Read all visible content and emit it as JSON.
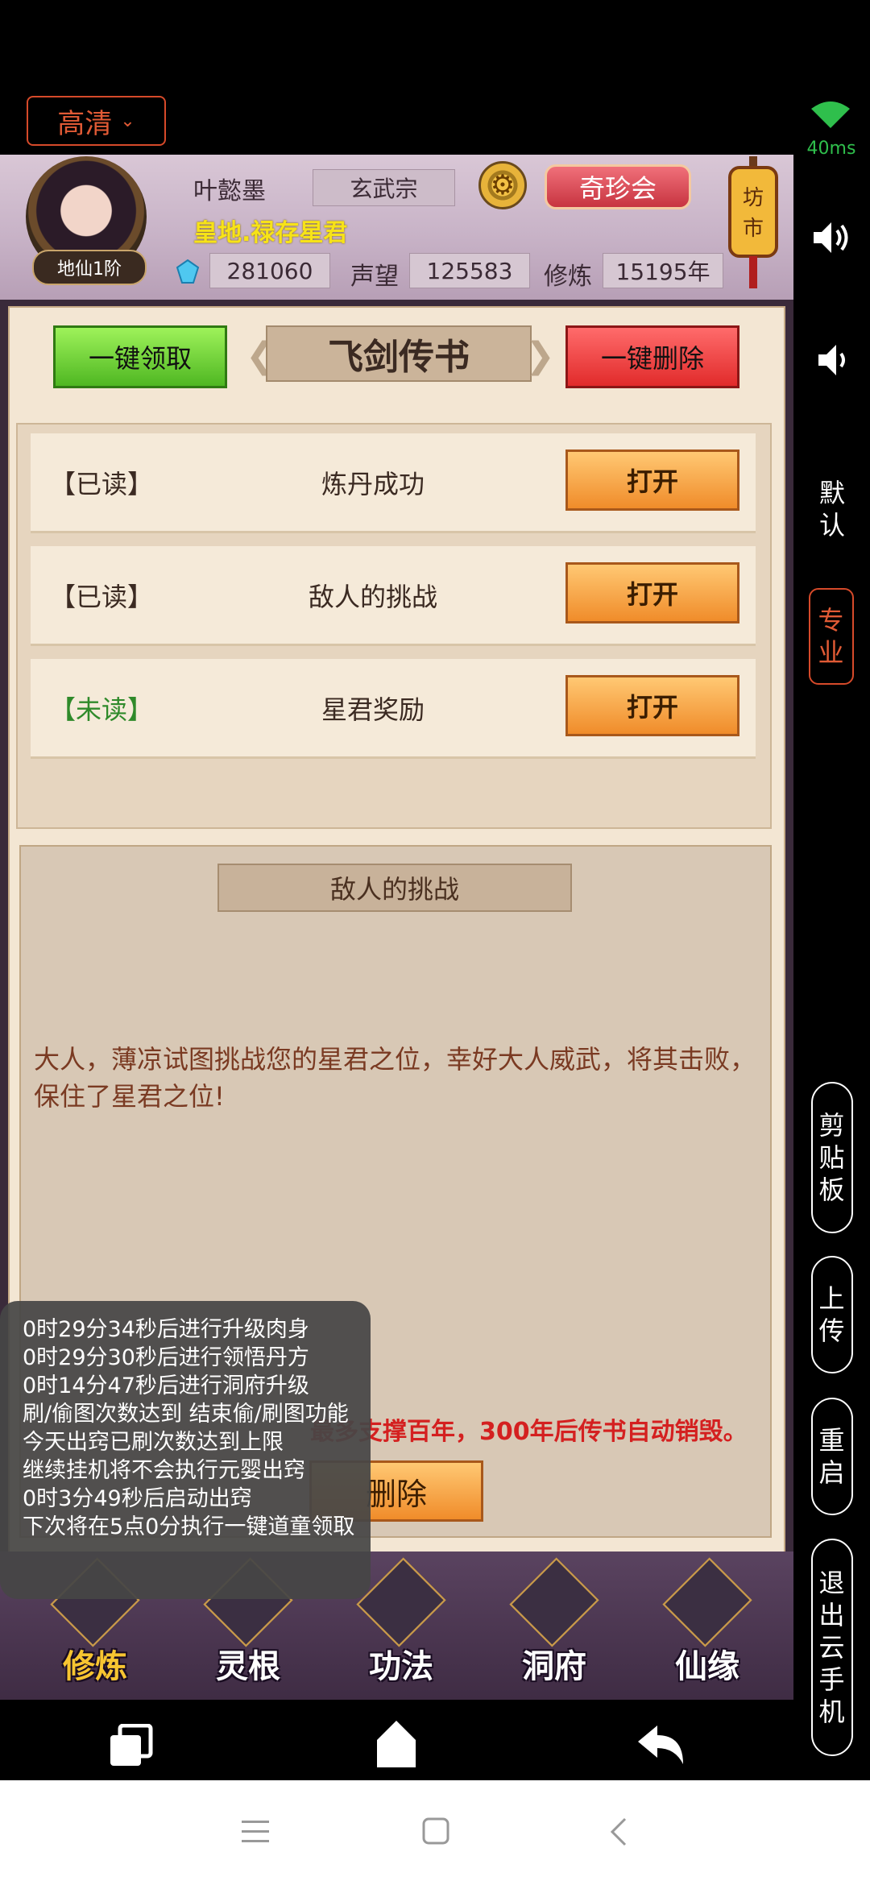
{
  "top_bar": {
    "quality_label": "高清",
    "ping": "40ms"
  },
  "header": {
    "player_name": "叶懿墨",
    "sect": "玄武宗",
    "treasure_button": "奇珍会",
    "market_label": "坊市",
    "title": "皇地.禄存星君",
    "rank": "地仙1阶",
    "spirit_stones": "281060",
    "reputation_label": "声望",
    "reputation": "125583",
    "cultivation_label": "修炼",
    "cultivation": "15195年"
  },
  "panel": {
    "claim_all": "一键领取",
    "title": "飞剑传书",
    "delete_all": "一键删除",
    "messages": [
      {
        "status": "【已读】",
        "title": "炼丹成功",
        "open": "打开"
      },
      {
        "status": "【已读】",
        "title": "敌人的挑战",
        "open": "打开"
      },
      {
        "status": "【未读】",
        "title": "星君奖励",
        "open": "打开"
      }
    ],
    "detail_title": "敌人的挑战",
    "detail_body": "大人，薄凉试图挑战您的星君之位，幸好大人威武，将其击败，保住了星君之位!",
    "notice": "最多支撑百年，300年后传书自动销毁。",
    "delete": "删除"
  },
  "bottom_nav": [
    "修炼",
    "灵根",
    "功法",
    "洞府",
    "仙缘"
  ],
  "log": [
    "0时29分34秒后进行升级肉身",
    "0时29分30秒后进行领悟丹方",
    "0时14分47秒后进行洞府升级",
    "刷/偷图次数达到 结束偷/刷图功能",
    "今天出窍已刷次数达到上限",
    "继续挂机将不会执行元婴出窍",
    "0时3分49秒后启动出窍",
    "下次将在5点0分执行一键道童领取"
  ],
  "side": {
    "default": "默认",
    "pro": "专业",
    "clipboard": "剪贴板",
    "upload": "上传",
    "restart": "重启",
    "exit": "退出云手机"
  },
  "colors": {
    "accent": "#e05a35",
    "title_yellow": "#f7e318",
    "notice_red": "#d42020"
  }
}
